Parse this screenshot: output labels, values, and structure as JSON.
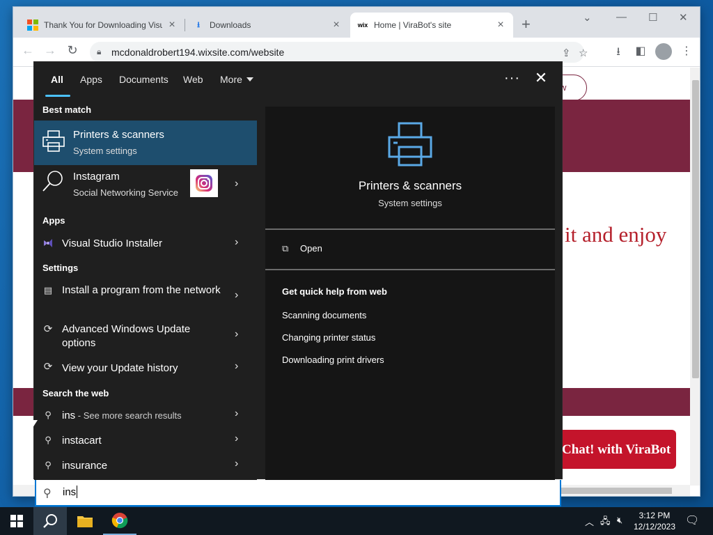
{
  "browser": {
    "tabs": [
      {
        "label": "Thank You for Downloading Visu",
        "icon": "microsoft-logo-icon"
      },
      {
        "label": "Downloads",
        "icon": "download-icon"
      },
      {
        "label": "Home | ViraBot's site",
        "icon": "wix-icon"
      }
    ],
    "url": "mcdonaldrobert194.wixsite.com/website",
    "wix_icon_text": "wix"
  },
  "page": {
    "pill_button_text": "w",
    "hero_text": "it and enjoy",
    "chat_button": "Chat! with ViraBot"
  },
  "search_panel": {
    "tabs": [
      {
        "label": "All",
        "active": true
      },
      {
        "label": "Apps"
      },
      {
        "label": "Documents"
      },
      {
        "label": "Web"
      },
      {
        "label": "More"
      }
    ],
    "sections": {
      "best_match": "Best match",
      "apps": "Apps",
      "settings": "Settings",
      "search_web": "Search the web"
    },
    "best_match": {
      "title": "Printers & scanners",
      "subtitle": "System settings"
    },
    "instagram": {
      "title": "Instagram",
      "subtitle": "Social Networking Service"
    },
    "apps": [
      {
        "label": "Visual Studio Installer"
      }
    ],
    "settings": [
      {
        "label": "Install a program from the network"
      },
      {
        "label": "Advanced Windows Update options"
      },
      {
        "label": "View your Update history"
      }
    ],
    "web": [
      {
        "label": "ins",
        "hint": " - See more search results"
      },
      {
        "label": "instacart"
      },
      {
        "label": "insurance"
      }
    ],
    "preview": {
      "title": "Printers & scanners",
      "subtitle": "System settings",
      "open": "Open",
      "quick_help_title": "Get quick help from web",
      "links": [
        "Scanning documents",
        "Changing printer status",
        "Downloading print drivers"
      ]
    },
    "query": "ins"
  },
  "taskbar": {
    "time": "3:12 PM",
    "date": "12/12/2023"
  },
  "colors": {
    "accent": "#4cc2ff",
    "highlight": "#1e4e6e",
    "brand": "#7a2540",
    "cta": "#c4142b"
  }
}
